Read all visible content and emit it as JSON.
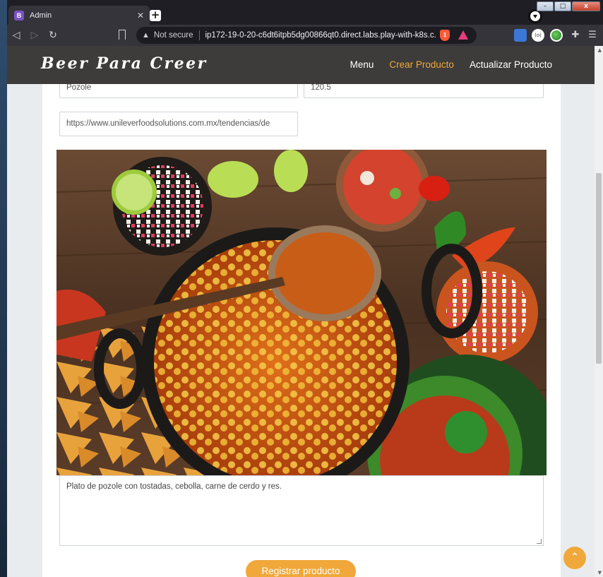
{
  "browser": {
    "tab_title": "Admin",
    "tab_icon_letter": "B",
    "security_label": "Not secure",
    "url": "ip172-19-0-20-c6dt6itpb5dg00866qt0.direct.labs.play-with-k8s.c...",
    "shield_count": "1"
  },
  "navbar": {
    "brand": "Beer Para Creer",
    "links": [
      "Menu",
      "Crear Producto",
      "Actualizar Producto"
    ]
  },
  "form": {
    "name_value": "Pozole",
    "price_value": "120.5",
    "image_url_value": "https://www.unileverfoodsolutions.com.mx/tendencias/de",
    "description_value": "Plato de pozole con tostadas, cebolla, carne de cerdo y res.",
    "submit_label": "Registrar producto"
  },
  "colors": {
    "accent": "#f0a83a",
    "navbar_bg": "#3d3c3a"
  }
}
